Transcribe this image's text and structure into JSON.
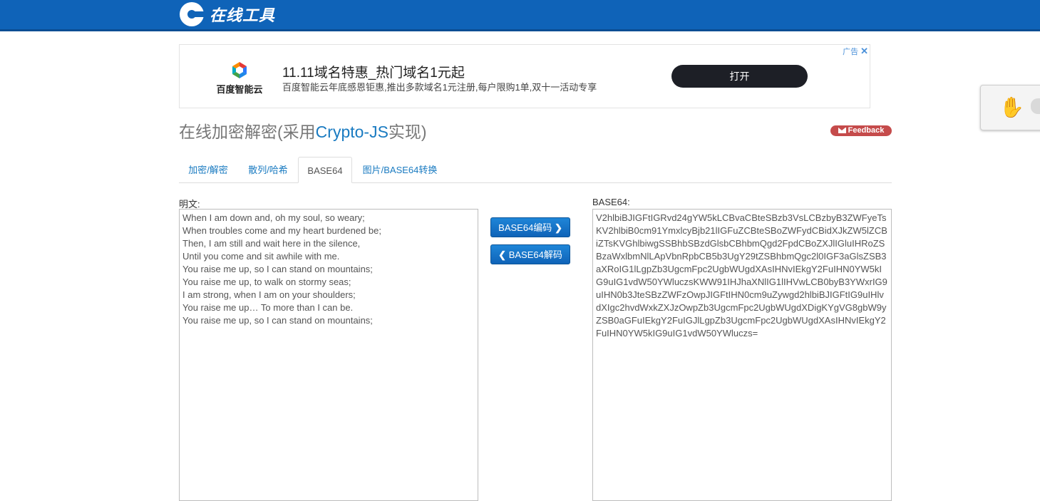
{
  "header": {
    "logo_text": "在线工具"
  },
  "ad": {
    "brand": "百度智能云",
    "title": "11.11域名特惠_热门域名1元起",
    "description": "百度智能云年底感恩钜惠,推出多款域名1元注册,每户限购1单,双十一活动专享",
    "button": "打开",
    "tag": "广告",
    "close": "✕"
  },
  "page": {
    "title_prefix": "在线加密解密(采用",
    "title_highlight": "Crypto-JS",
    "title_suffix": "实现)",
    "feedback": "Feedback"
  },
  "tabs": [
    {
      "label": "加密/解密"
    },
    {
      "label": "散列/哈希"
    },
    {
      "label": "BASE64"
    },
    {
      "label": "图片/BASE64转换"
    }
  ],
  "form": {
    "plain_label": "明文:",
    "plain_text": "When I am down and, oh my soul, so weary;\nWhen troubles come and my heart burdened be;\nThen, I am still and wait here in the silence,\nUntil you come and sit awhile with me.\nYou raise me up, so I can stand on mountains;\nYou raise me up, to walk on stormy seas;\nI am strong, when I am on your shoulders;\nYou raise me up… To more than I can be.\nYou raise me up, so I can stand on mountains;",
    "encode_button": "BASE64编码",
    "decode_button": "BASE64解码",
    "b64_label": "BASE64:",
    "b64_text": "V2hlbiBJIGFtIGRvd24gYW5kLCBvaCBteSBzb3VsLCBzbyB3ZWFyeTsKV2hlbiB0cm91YmxlcyBjb21lIGFuZCBteSBoZWFydCBidXJkZW5lZCBiZTsKVGhlbiwgSSBhbSBzdGlsbCBhbmQgd2FpdCBoZXJlIGluIHRoZSBzaWxlbmNlLApVbnRpbCB5b3UgY29tZSBhbmQgc2l0IGF3aGlsZSB3aXRoIG1lLgpZb3UgcmFpc2UgbWUgdXAsIHNvIEkgY2FuIHN0YW5kIG9uIG1vdW50YWluczsKWW91IHJhaXNlIG1lIHVwLCB0byB3YWxrIG9uIHN0b3JteSBzZWFzOwpJIGFtIHN0cm9uZywgd2hlbiBJIGFtIG9uIHlvdXIgc2hvdWxkZXJzOwpZb3UgcmFpc2UgbWUgdXDigKYgVG8gbW9yZSB0aGFuIEkgY2FuIGJlLgpZb3UgcmFpc2UgbWUgdXAsIHNvIEkgY2FuIHN0YW5kIG9uIG1vdW50YWluczs="
  }
}
